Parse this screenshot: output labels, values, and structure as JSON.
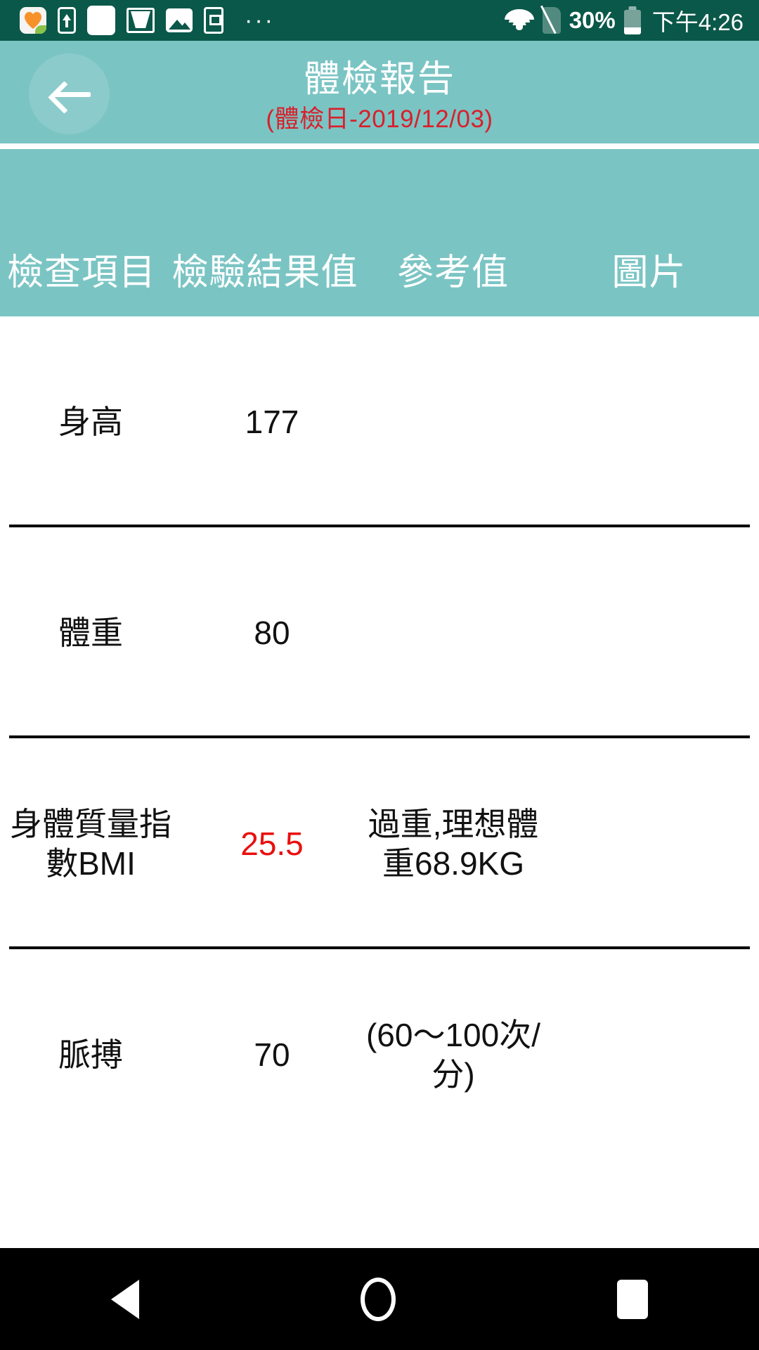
{
  "statusbar": {
    "icons_left": [
      "health-app-icon",
      "share-icon",
      "blank-notification-icon",
      "gmail-icon",
      "photos-icon",
      "sim-toolkit-icon",
      "more-notifications-icon"
    ],
    "more_glyph": "···",
    "wifi_icon": "wifi-icon",
    "sim_icon": "no-sim-icon",
    "battery_percent": "30%",
    "battery_level": 30,
    "battery_icon": "battery-icon",
    "time": "下午4:26",
    "background": "#0A5849"
  },
  "appbar": {
    "back_label": "back-arrow",
    "title": "體檢報告",
    "subtitle": "(體檢日-2019/12/03)",
    "background": "#7BC4C4",
    "subtitle_color": "#D8202B"
  },
  "table": {
    "headers": [
      "檢查項目",
      "檢驗結果值",
      "參考值",
      "圖片"
    ],
    "rows": [
      {
        "item": "身高",
        "result": "177",
        "reference": "",
        "image": "",
        "abnormal": false
      },
      {
        "item": "體重",
        "result": "80",
        "reference": "",
        "image": "",
        "abnormal": false
      },
      {
        "item": "身體質量指數BMI",
        "result": "25.5",
        "reference": "過重,理想體重68.9KG",
        "image": "",
        "abnormal": true
      },
      {
        "item": "脈搏",
        "result": "70",
        "reference": "(60～100次/分)",
        "image": "",
        "abnormal": false
      }
    ],
    "abnormal_color": "#E8100F",
    "text_color": "#111111"
  },
  "navbar": {
    "back": "nav-back-triangle",
    "home": "nav-home-circle",
    "recents": "nav-recents-square",
    "background": "#000000"
  }
}
